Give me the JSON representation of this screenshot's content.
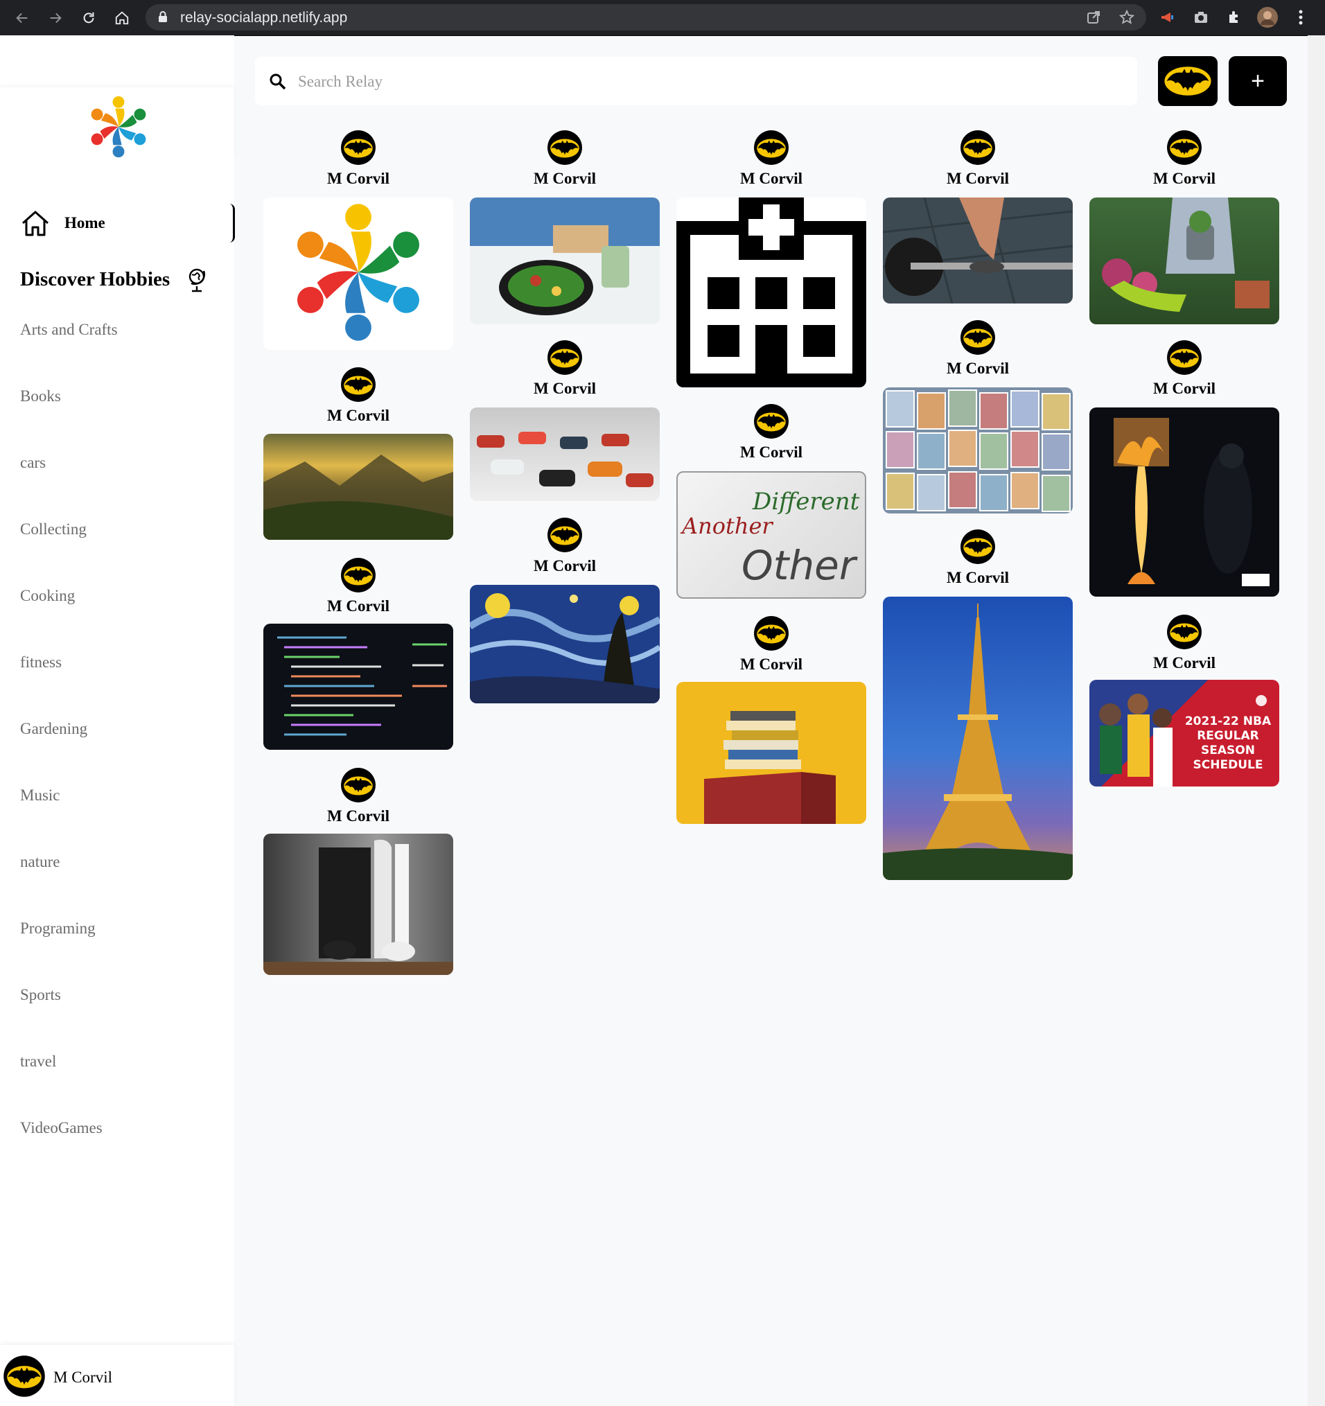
{
  "browser": {
    "url": "relay-socialapp.netlify.app"
  },
  "sidebar": {
    "home_label": "Home",
    "discover_label": "Discover Hobbies",
    "categories": [
      "Arts and Crafts",
      "Books",
      "cars",
      "Collecting",
      "Cooking",
      "fitness",
      "Gardening",
      "Music",
      "nature",
      "Programing",
      "Sports",
      "travel",
      "VideoGames"
    ],
    "user_name": "M Corvil"
  },
  "header": {
    "search_placeholder": "Search Relay",
    "create_label": "+"
  },
  "pins": [
    {
      "author": "M Corvil",
      "image": "relay-logo"
    },
    {
      "author": "M Corvil",
      "image": "mountain-landscape"
    },
    {
      "author": "M Corvil",
      "image": "code-screen"
    },
    {
      "author": "M Corvil",
      "image": "game-consoles"
    },
    {
      "author": "M Corvil",
      "image": "cooking-pan"
    },
    {
      "author": "M Corvil",
      "image": "car-collection"
    },
    {
      "author": "M Corvil",
      "image": "starry-night"
    },
    {
      "author": "M Corvil",
      "image": "hospital-icon"
    },
    {
      "author": "M Corvil",
      "image": "whiteboard-text",
      "words": [
        "Different",
        "Another",
        "Other"
      ]
    },
    {
      "author": "M Corvil",
      "image": "book-stack"
    },
    {
      "author": "M Corvil",
      "image": "barbell-lift"
    },
    {
      "author": "M Corvil",
      "image": "trading-cards"
    },
    {
      "author": "M Corvil",
      "image": "eiffel-tower"
    },
    {
      "author": "M Corvil",
      "image": "gardening"
    },
    {
      "author": "M Corvil",
      "image": "album-cover-fire"
    },
    {
      "author": "M Corvil",
      "image": "nba-schedule",
      "words": [
        "2021-22 NBA",
        "REGULAR SEASON",
        "SCHEDULE"
      ]
    }
  ]
}
